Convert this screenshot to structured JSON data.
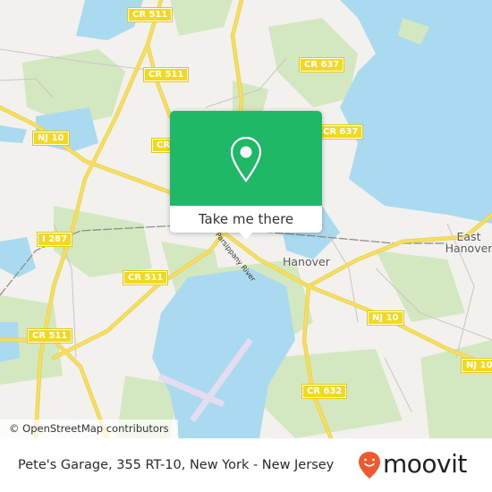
{
  "map": {
    "colors": {
      "land": "#f2f1ee",
      "water": "#aadaf0",
      "park": "#d3e8c0",
      "road": "#f6df5e",
      "runway": "#e6dcf2",
      "popup_green": "#1fb867",
      "moovit_orange": "#f0582d"
    },
    "road_labels": [
      {
        "id": "cr511-top",
        "text": "CR 511"
      },
      {
        "id": "cr511-mid",
        "text": "CR 511"
      },
      {
        "id": "cr511-partial",
        "text": "CR"
      },
      {
        "id": "nj10-left",
        "text": "NJ 10"
      },
      {
        "id": "cr637-top",
        "text": "CR 637"
      },
      {
        "id": "cr637-mid",
        "text": "CR 637"
      },
      {
        "id": "i287",
        "text": "I 287"
      },
      {
        "id": "cr511-lower",
        "text": "CR 511"
      },
      {
        "id": "cr511-left",
        "text": "CR 511"
      },
      {
        "id": "nj10-mid",
        "text": "NJ 10"
      },
      {
        "id": "nj10-right",
        "text": "NJ 10"
      },
      {
        "id": "cr632",
        "text": "CR 632"
      }
    ],
    "place_labels": [
      {
        "id": "hanover",
        "text": "Hanover"
      },
      {
        "id": "east-hanover",
        "text": "East Hanover"
      }
    ],
    "river_label": "Parsippany River",
    "attribution": "© OpenStreetMap contributors"
  },
  "popup": {
    "icon": "map-pin-icon",
    "button_label": "Take me there"
  },
  "footer": {
    "title": "Pete's Garage, 355 RT-10, New York - New Jersey",
    "logo_text": "moovit"
  }
}
